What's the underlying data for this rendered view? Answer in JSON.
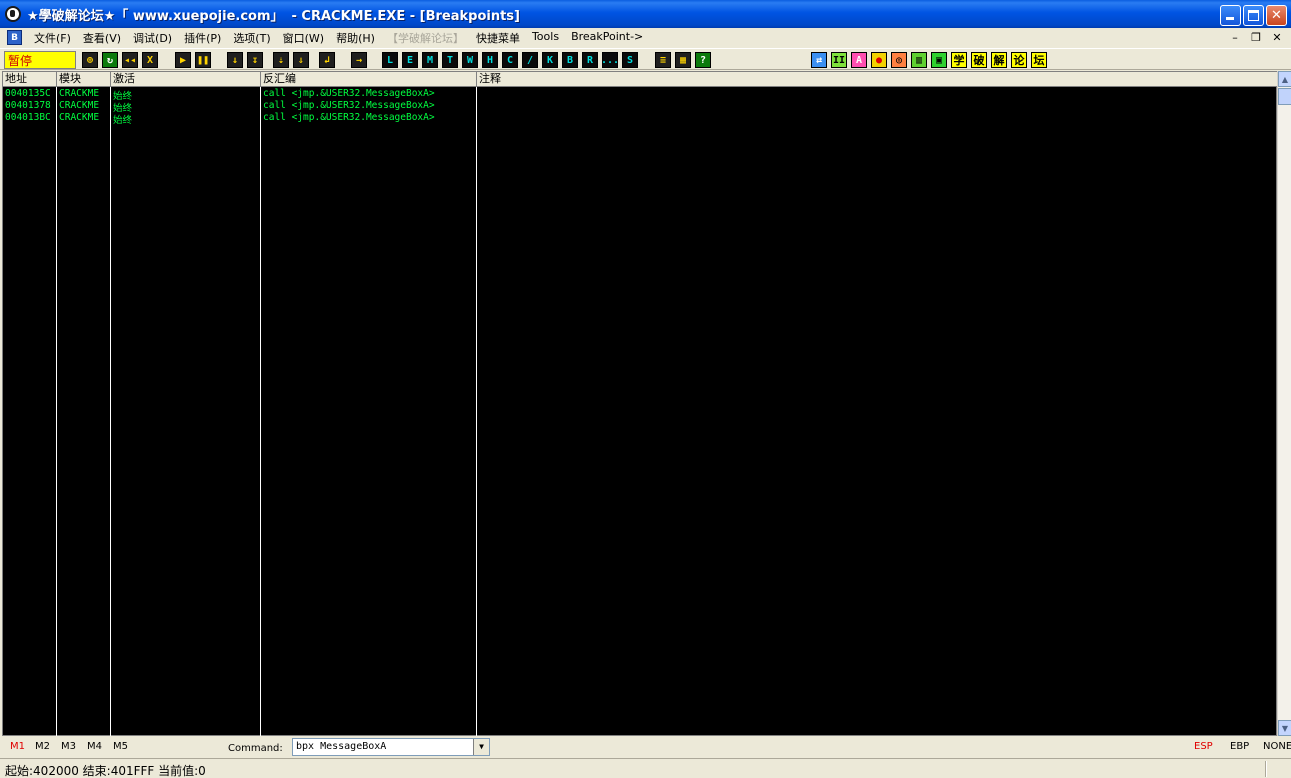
{
  "window": {
    "title_left": "★學破解论坛★「 www.xuepojie.com」",
    "title_right": "- CRACKME.EXE - [Breakpoints]"
  },
  "menu": {
    "items": [
      {
        "label": "文件(F)",
        "disabled": false
      },
      {
        "label": "查看(V)",
        "disabled": false
      },
      {
        "label": "调试(D)",
        "disabled": false
      },
      {
        "label": "插件(P)",
        "disabled": false
      },
      {
        "label": "选项(T)",
        "disabled": false
      },
      {
        "label": "窗口(W)",
        "disabled": false
      },
      {
        "label": "帮助(H)",
        "disabled": false
      },
      {
        "label": "【学破解论坛】",
        "disabled": true
      },
      {
        "label": "快捷菜单",
        "disabled": false
      },
      {
        "label": "Tools",
        "disabled": false
      },
      {
        "label": "BreakPoint->",
        "disabled": false
      }
    ]
  },
  "toolbar": {
    "status": "暂停",
    "letter_buttons": [
      "L",
      "E",
      "M",
      "T",
      "W",
      "H",
      "C",
      "/",
      "K",
      "B",
      "R",
      "...",
      "S"
    ],
    "right_labels": [
      "学",
      "破",
      "解",
      "论",
      "坛"
    ]
  },
  "table": {
    "headers": [
      "地址",
      "模块",
      "激活",
      "反汇编",
      "注释"
    ],
    "rows": [
      {
        "address": "0040135C",
        "module": "CRACKME",
        "active": "始终",
        "disasm": "call <jmp.&USER32.MessageBoxA>",
        "comment": ""
      },
      {
        "address": "00401378",
        "module": "CRACKME",
        "active": "始终",
        "disasm": "call <jmp.&USER32.MessageBoxA>",
        "comment": ""
      },
      {
        "address": "004013BC",
        "module": "CRACKME",
        "active": "始终",
        "disasm": "call <jmp.&USER32.MessageBoxA>",
        "comment": ""
      }
    ]
  },
  "bottom": {
    "marks": [
      "M1",
      "M2",
      "M3",
      "M4",
      "M5"
    ],
    "command_label": "Command:",
    "command_value": "bpx MessageBoxA",
    "registers": [
      "ESP",
      "EBP",
      "NONE"
    ]
  },
  "status": {
    "text": "起始:402000 结束:401FFF 当前值:0"
  }
}
